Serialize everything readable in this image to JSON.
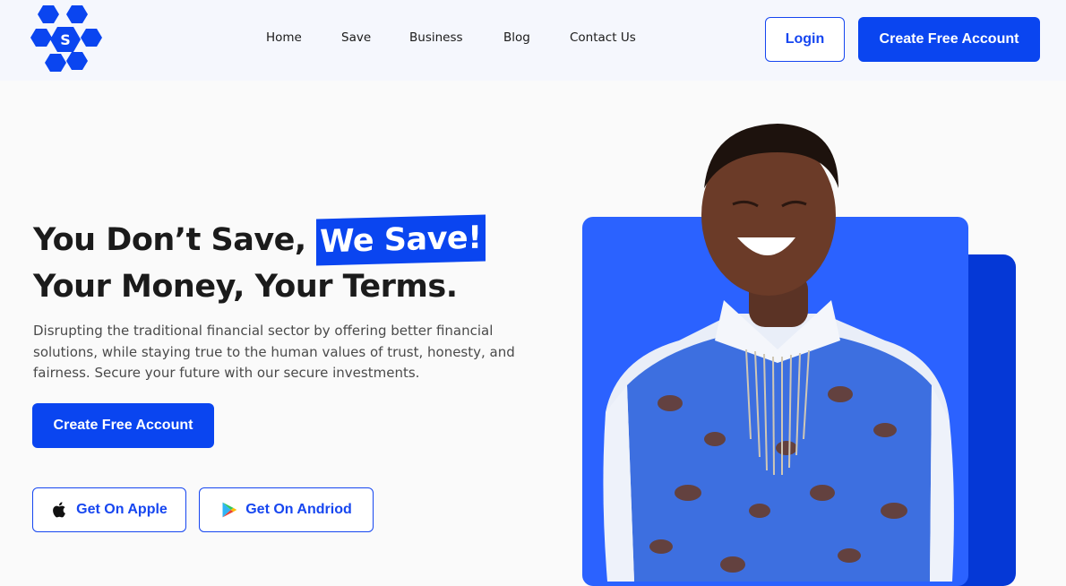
{
  "header": {
    "logo_letter": "S",
    "nav": [
      "Home",
      "Save",
      "Business",
      "Blog",
      "Contact Us"
    ],
    "login_label": "Login",
    "create_account_label": "Create Free Account"
  },
  "hero": {
    "title_part1": "You Don’t Save, ",
    "title_highlight": "We Save!",
    "title_line2": "Your Money, Your Terms.",
    "description": "Disrupting the traditional financial sector by offering better financial solutions, while staying true to the human values of trust, honesty, and fairness. Secure your future with our secure investments.",
    "cta_label": "Create Free Account",
    "apple_label": "Get On Apple",
    "android_label": "Get On Andriod"
  },
  "colors": {
    "brand_blue": "#0a45f0",
    "panel_blue": "#2b62ff",
    "panel_dark_blue": "#0538d6"
  },
  "icons": {
    "apple": "apple-icon",
    "play": "google-play-icon"
  }
}
